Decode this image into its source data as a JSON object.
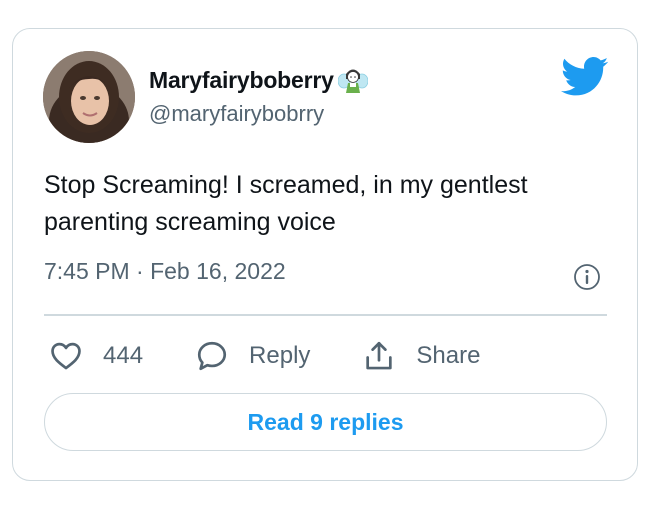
{
  "tweet": {
    "author": {
      "display_name": "Maryfairyboberry",
      "name_emoji": "fairy-emoji",
      "handle": "@maryfairybobrry"
    },
    "text": "Stop Screaming! I screamed, in my gentlest parenting screaming voice",
    "timestamp": "7:45 PM · Feb 16, 2022"
  },
  "actions": {
    "like_count": "444",
    "reply_label": "Reply",
    "share_label": "Share"
  },
  "read_replies_label": "Read 9 replies",
  "icons": {
    "brand": "twitter-bird-icon",
    "info": "info-icon",
    "like": "heart-icon",
    "reply": "speech-bubble-icon",
    "share": "share-upload-icon"
  },
  "colors": {
    "brand_blue": "#1d9bf0",
    "text_primary": "#0f1419",
    "text_secondary": "#536471",
    "border": "#cfd9de"
  }
}
